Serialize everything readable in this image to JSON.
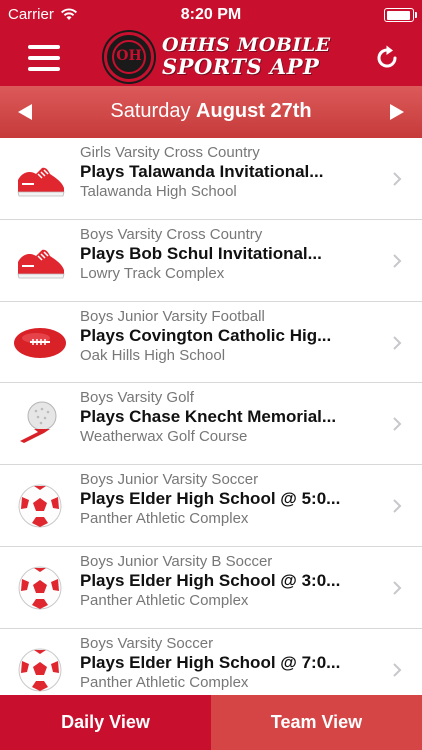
{
  "status": {
    "carrier": "Carrier",
    "time": "8:20 PM",
    "wifi_icon": "wifi-icon",
    "battery_icon": "battery-icon"
  },
  "header": {
    "logo_monogram": "OH",
    "title_line1": "OHHS MOBILE",
    "title_line2": "SPORTS APP",
    "menu_icon": "hamburger-menu-icon",
    "refresh_icon": "refresh-icon"
  },
  "date_bar": {
    "weekday": "Saturday",
    "date": "August 27th",
    "prev_icon": "triangle-left-icon",
    "next_icon": "triangle-right-icon"
  },
  "events": [
    {
      "sport": "Girls Varsity Cross Country",
      "event": "Plays Talawanda Invitational...",
      "venue": "Talawanda High School",
      "icon": "running-shoe-icon"
    },
    {
      "sport": "Boys Varsity Cross Country",
      "event": "Plays Bob Schul Invitational...",
      "venue": "Lowry Track Complex",
      "icon": "running-shoe-icon"
    },
    {
      "sport": "Boys Junior Varsity Football",
      "event": "Plays Covington Catholic Hig...",
      "venue": "Oak Hills High School",
      "icon": "football-icon"
    },
    {
      "sport": "Boys Varsity Golf",
      "event": "Plays Chase Knecht Memorial...",
      "venue": "Weatherwax Golf Course",
      "icon": "golf-ball-tee-icon"
    },
    {
      "sport": "Boys Junior Varsity Soccer",
      "event": "Plays Elder High School @ 5:0...",
      "venue": "Panther Athletic Complex",
      "icon": "soccer-ball-icon"
    },
    {
      "sport": "Boys Junior Varsity B Soccer",
      "event": "Plays Elder High School @ 3:0...",
      "venue": "Panther Athletic Complex",
      "icon": "soccer-ball-icon"
    },
    {
      "sport": "Boys Varsity Soccer",
      "event": "Plays Elder High School @ 7:0...",
      "venue": "Panther Athletic Complex",
      "icon": "soccer-ball-icon"
    }
  ],
  "tabs": {
    "daily": "Daily View",
    "team": "Team View"
  },
  "colors": {
    "primary": "#c8102e",
    "date_bar": "#cf4545",
    "secondary_text": "#777777"
  }
}
